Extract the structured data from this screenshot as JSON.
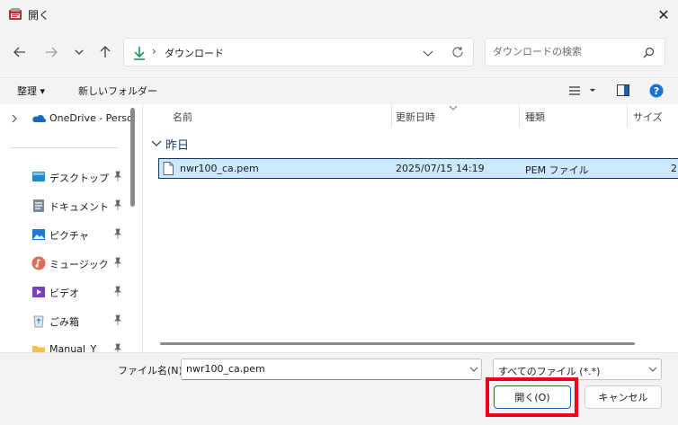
{
  "window": {
    "title": "開く",
    "close_label": "✕"
  },
  "nav": {
    "back_icon": "arrow-left-icon",
    "forward_icon": "arrow-right-icon",
    "recent_icon": "chevron-down-icon",
    "up_icon": "arrow-up-icon",
    "address": {
      "separator": "›",
      "location": "ダウンロード"
    },
    "search_placeholder": "ダウンロードの検索"
  },
  "toolbar": {
    "organize_label": "整理 ▾",
    "new_folder_label": "新しいフォルダー"
  },
  "sidebar": {
    "onedrive_label": "OneDrive - Perso",
    "items": [
      {
        "label": "デスクトップ",
        "icon": "desktop-icon"
      },
      {
        "label": "ドキュメント",
        "icon": "documents-icon"
      },
      {
        "label": "ピクチャ",
        "icon": "pictures-icon"
      },
      {
        "label": "ミュージック",
        "icon": "music-icon"
      },
      {
        "label": "ビデオ",
        "icon": "video-icon"
      },
      {
        "label": "ごみ箱",
        "icon": "recycle-bin-icon"
      },
      {
        "label": "Manual_Y",
        "icon": "folder-icon"
      }
    ]
  },
  "file_list": {
    "columns": [
      "名前",
      "更新日時",
      "種類",
      "サイズ"
    ],
    "group_label": "昨日",
    "rows": [
      {
        "name": "nwr100_ca.pem",
        "modified": "2025/07/15 14:19",
        "type": "PEM ファイル",
        "size": "2"
      }
    ]
  },
  "bottom": {
    "filename_label": "ファイル名(N):",
    "filename_value": "nwr100_ca.pem",
    "filetype_value": "すべてのファイル (*.*)",
    "open_label": "開く(O)",
    "cancel_label": "キャンセル"
  },
  "colors": {
    "accent": "#0067c0",
    "selection_bg": "#cce8ff",
    "highlight_red": "#e8001c"
  }
}
